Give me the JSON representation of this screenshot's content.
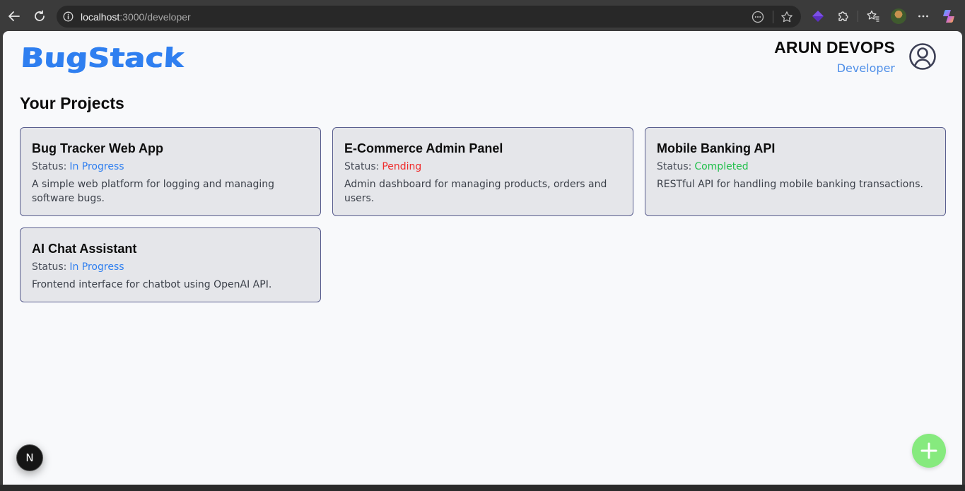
{
  "browser": {
    "url_host": "localhost",
    "url_path": ":3000/developer"
  },
  "header": {
    "logo": "BugStack",
    "user_name": "ARUN DEVOPS",
    "user_role": "Developer"
  },
  "section_title": "Your Projects",
  "projects": [
    {
      "title": "Bug Tracker Web App",
      "status_label": "Status:",
      "status": "In Progress",
      "status_color": "#2f7ff0",
      "description": "A simple web platform for logging and managing software bugs."
    },
    {
      "title": "E-Commerce Admin Panel",
      "status_label": "Status:",
      "status": "Pending",
      "status_color": "#ef2b2b",
      "description": "Admin dashboard for managing products, orders and users."
    },
    {
      "title": "Mobile Banking API",
      "status_label": "Status:",
      "status": "Completed",
      "status_color": "#1fbf4a",
      "description": "RESTful API for handling mobile banking transactions."
    },
    {
      "title": "AI Chat Assistant",
      "status_label": "Status:",
      "status": "In Progress",
      "status_color": "#2f7ff0",
      "description": "Frontend interface for chatbot using OpenAI API."
    }
  ],
  "next_badge": "N",
  "icons": {
    "fab": "plus-icon",
    "user": "user-circle-icon"
  },
  "colors": {
    "brand": "#2f7ff0",
    "fab": "#86ea7e"
  }
}
